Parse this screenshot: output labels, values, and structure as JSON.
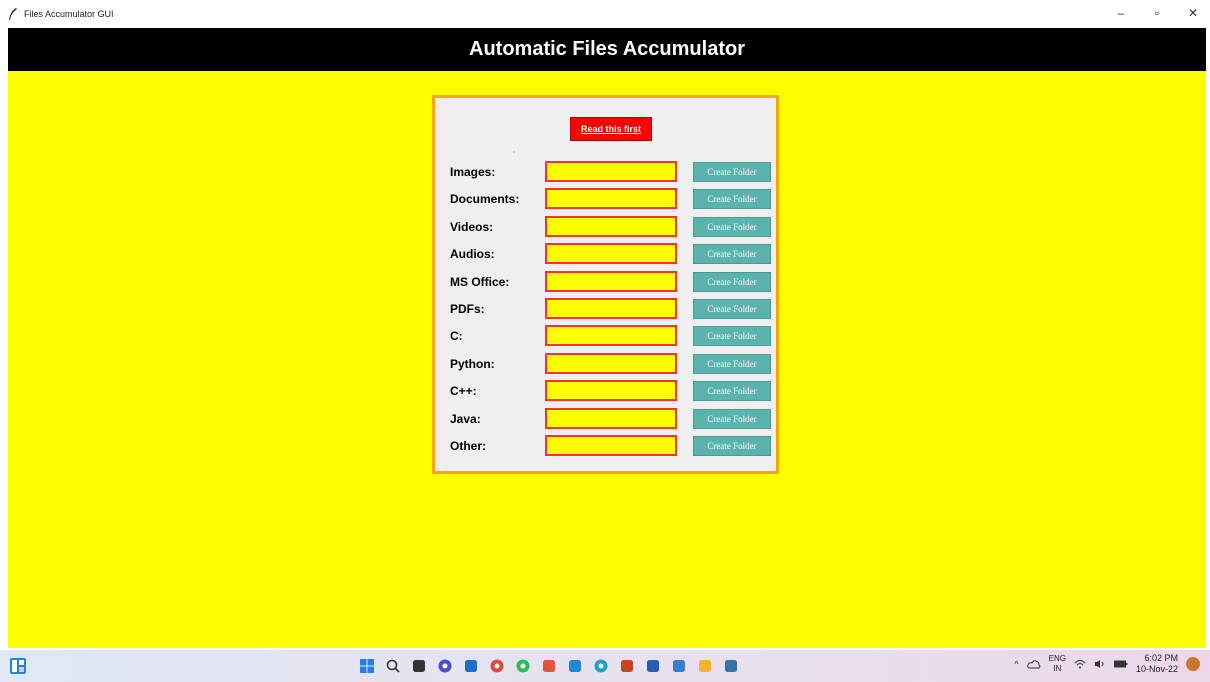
{
  "window": {
    "title": "Files Accumulator GUI",
    "controls": {
      "minimize": "–",
      "maximize": "▫",
      "close": "✕"
    }
  },
  "app": {
    "header": "Automatic Files Accumulator",
    "read_button": "Read this first",
    "create_label": "Create Folder",
    "colors": {
      "background": "#ffff00",
      "header": "#000000",
      "panel": "#efefef",
      "panel_border": "#ffa500",
      "read_button": "#ff0000",
      "create_button": "#5ab4ad",
      "input_border": "#ff3030"
    },
    "rows": [
      {
        "label": "Images:",
        "value": ""
      },
      {
        "label": "Documents:",
        "value": ""
      },
      {
        "label": "Videos:",
        "value": ""
      },
      {
        "label": "Audios:",
        "value": ""
      },
      {
        "label": "MS Office:",
        "value": ""
      },
      {
        "label": "PDFs:",
        "value": ""
      },
      {
        "label": "C:",
        "value": ""
      },
      {
        "label": "Python:",
        "value": ""
      },
      {
        "label": "C++:",
        "value": ""
      },
      {
        "label": "Java:",
        "value": ""
      },
      {
        "label": "Other:",
        "value": ""
      }
    ]
  },
  "taskbar": {
    "apps": [
      {
        "name": "windows-start-icon",
        "color": "#2b7de0"
      },
      {
        "name": "search-icon",
        "color": "#333333"
      },
      {
        "name": "task-view-icon",
        "color": "#333333"
      },
      {
        "name": "chat-icon",
        "color": "#4b4fc9"
      },
      {
        "name": "store-icon",
        "color": "#1f6fd1"
      },
      {
        "name": "chrome-icon",
        "color": "#e04a3a"
      },
      {
        "name": "whatsapp-icon",
        "color": "#25c05a"
      },
      {
        "name": "brave-icon",
        "color": "#e2553a"
      },
      {
        "name": "vscode-icon",
        "color": "#1e88d9"
      },
      {
        "name": "edge-icon",
        "color": "#1ba0c9"
      },
      {
        "name": "powerpoint-icon",
        "color": "#c94320"
      },
      {
        "name": "word-icon",
        "color": "#2b5cb8"
      },
      {
        "name": "notepad-icon",
        "color": "#3a7bd5"
      },
      {
        "name": "file-explorer-icon",
        "color": "#f0b429"
      },
      {
        "name": "python-app-icon",
        "color": "#3771a8"
      }
    ],
    "tray": {
      "chevron": "^",
      "lang_top": "ENG",
      "lang_bottom": "IN",
      "time": "6:02 PM",
      "date": "10-Nov-22"
    }
  }
}
